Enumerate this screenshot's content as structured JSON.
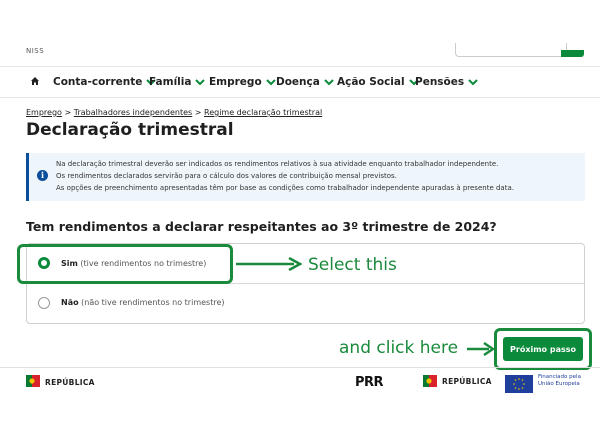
{
  "header": {
    "niss_label": "NISS"
  },
  "nav": {
    "items": [
      {
        "label": "Conta-corrente"
      },
      {
        "label": "Família"
      },
      {
        "label": "Emprego"
      },
      {
        "label": "Doença"
      },
      {
        "label": "Ação Social"
      },
      {
        "label": "Pensões"
      }
    ]
  },
  "breadcrumb": {
    "items": [
      "Emprego",
      "Trabalhadores independentes",
      "Regime declaração trimestral"
    ],
    "separator": ">"
  },
  "page_title": "Declaração trimestral",
  "info": {
    "lines": [
      "Na declaração trimestral deverão ser indicados os rendimentos relativos à sua atividade enquanto trabalhador independente.",
      "Os rendimentos declarados servirão para o cálculo dos valores de contribuição mensal previstos.",
      "As opções de preenchimento apresentadas têm por base as condições como trabalhador independente apuradas à presente data."
    ]
  },
  "question": "Tem rendimentos a declarar respeitantes ao 3º trimestre de 2024?",
  "options": [
    {
      "label": "Sim",
      "hint": "(tive rendimentos no trimestre)",
      "selected": true
    },
    {
      "label": "Não",
      "hint": "(não tive rendimentos no trimestre)",
      "selected": false
    }
  ],
  "annotations": {
    "select_text": "Select this",
    "click_text": "and click here"
  },
  "next_button": "Próximo passo",
  "footer": {
    "republica_left": "REPÚBLICA",
    "prr": "PRR",
    "republica_right": "REPÚBLICA",
    "eu_line1": "Financiado pela",
    "eu_line2": "União Europeia"
  },
  "colors": {
    "primary_green": "#0a8a3a",
    "annotation_green": "#1a8a3c",
    "info_accent": "#0b4f9c",
    "info_background": "#eef6fb"
  }
}
